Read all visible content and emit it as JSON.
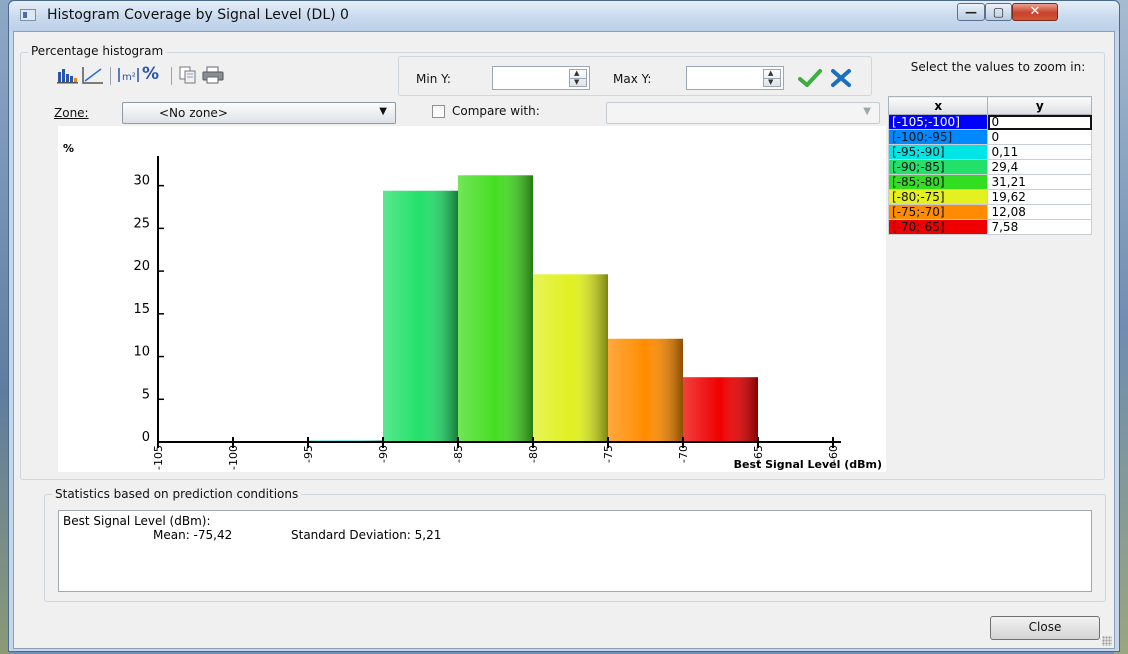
{
  "window": {
    "title": "Histogram   Coverage by Signal Level (DL) 0"
  },
  "titlebar_buttons": {
    "minimize": "—",
    "maximize": "▢",
    "close": "✕"
  },
  "histogram_group": {
    "title": "Percentage histogram"
  },
  "toolbar": {
    "percent_label": "%",
    "min_y_label": "Min Y:",
    "min_y_value": "",
    "max_y_label": "Max Y:",
    "max_y_value": ""
  },
  "zone": {
    "label": "Zone:",
    "selected": "<No zone>"
  },
  "compare": {
    "label": "Compare with:",
    "checked": false,
    "selected": ""
  },
  "zoom_panel": {
    "title": "Select the values to zoom in:",
    "columns": [
      "x",
      "y"
    ],
    "rows": [
      {
        "x": "[-105;-100]",
        "y": "0",
        "color": "#0000ff",
        "fg": "#ffffff"
      },
      {
        "x": "[-100;-95]",
        "y": "0",
        "color": "#0088ff",
        "fg": "#111111"
      },
      {
        "x": "[-95;-90]",
        "y": "0,11",
        "color": "#00e6e6",
        "fg": "#111111"
      },
      {
        "x": "[-90;-85]",
        "y": "29,4",
        "color": "#22e06a",
        "fg": "#111111"
      },
      {
        "x": "[-85;-80]",
        "y": "31,21",
        "color": "#33dd22",
        "fg": "#111111"
      },
      {
        "x": "[-80;-75]",
        "y": "19,62",
        "color": "#e4f020",
        "fg": "#111111"
      },
      {
        "x": "[-75;-70]",
        "y": "12,08",
        "color": "#ff8c00",
        "fg": "#111111"
      },
      {
        "x": "[-70;-65]",
        "y": "7,58",
        "color": "#ee0000",
        "fg": "#111111"
      }
    ]
  },
  "stats_group": {
    "title": "Statistics based on prediction conditions",
    "heading": "Best Signal Level (dBm):",
    "mean": "Mean: -75,42",
    "std": "Standard Deviation: 5,21"
  },
  "buttons": {
    "close": "Close"
  },
  "chart_data": {
    "type": "bar",
    "ylabel": "%",
    "xlabel": "Best Signal Level (dBm)",
    "xlim": [
      -105,
      -60
    ],
    "ylim": [
      0,
      33
    ],
    "x_ticks": [
      -105,
      -100,
      -95,
      -90,
      -85,
      -80,
      -75,
      -70,
      -65,
      -60
    ],
    "y_ticks": [
      0,
      5,
      10,
      15,
      20,
      25,
      30
    ],
    "bins": [
      {
        "from": -105,
        "to": -100,
        "value": 0,
        "color": "#0000ff"
      },
      {
        "from": -100,
        "to": -95,
        "value": 0,
        "color": "#0088ff"
      },
      {
        "from": -95,
        "to": -90,
        "value": 0.11,
        "color": "#00d8d8"
      },
      {
        "from": -90,
        "to": -85,
        "value": 29.4,
        "color": "#22e06a"
      },
      {
        "from": -85,
        "to": -80,
        "value": 31.21,
        "color": "#44dd22"
      },
      {
        "from": -80,
        "to": -75,
        "value": 19.62,
        "color": "#e0f020"
      },
      {
        "from": -75,
        "to": -70,
        "value": 12.08,
        "color": "#ff8c00"
      },
      {
        "from": -70,
        "to": -65,
        "value": 7.58,
        "color": "#ee0000"
      }
    ],
    "grid": false,
    "legend": "none"
  }
}
